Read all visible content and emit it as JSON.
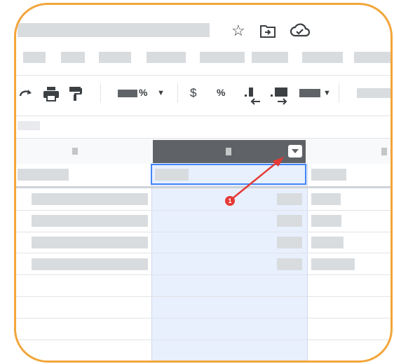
{
  "toolbar": {
    "star_icon": "star-icon",
    "move_icon": "move-to-folder-icon",
    "cloud_icon": "cloud-saved-icon",
    "zoom_suffix": "%",
    "currency_label": "$",
    "percent_label": "%"
  },
  "annotation": {
    "step_number": "1",
    "color": "#e53935"
  },
  "colors": {
    "frame": "#f2a53a",
    "selected_column": "#e8f0fe",
    "selected_cell_border": "#4285f4",
    "header_selected": "#5f6368"
  }
}
